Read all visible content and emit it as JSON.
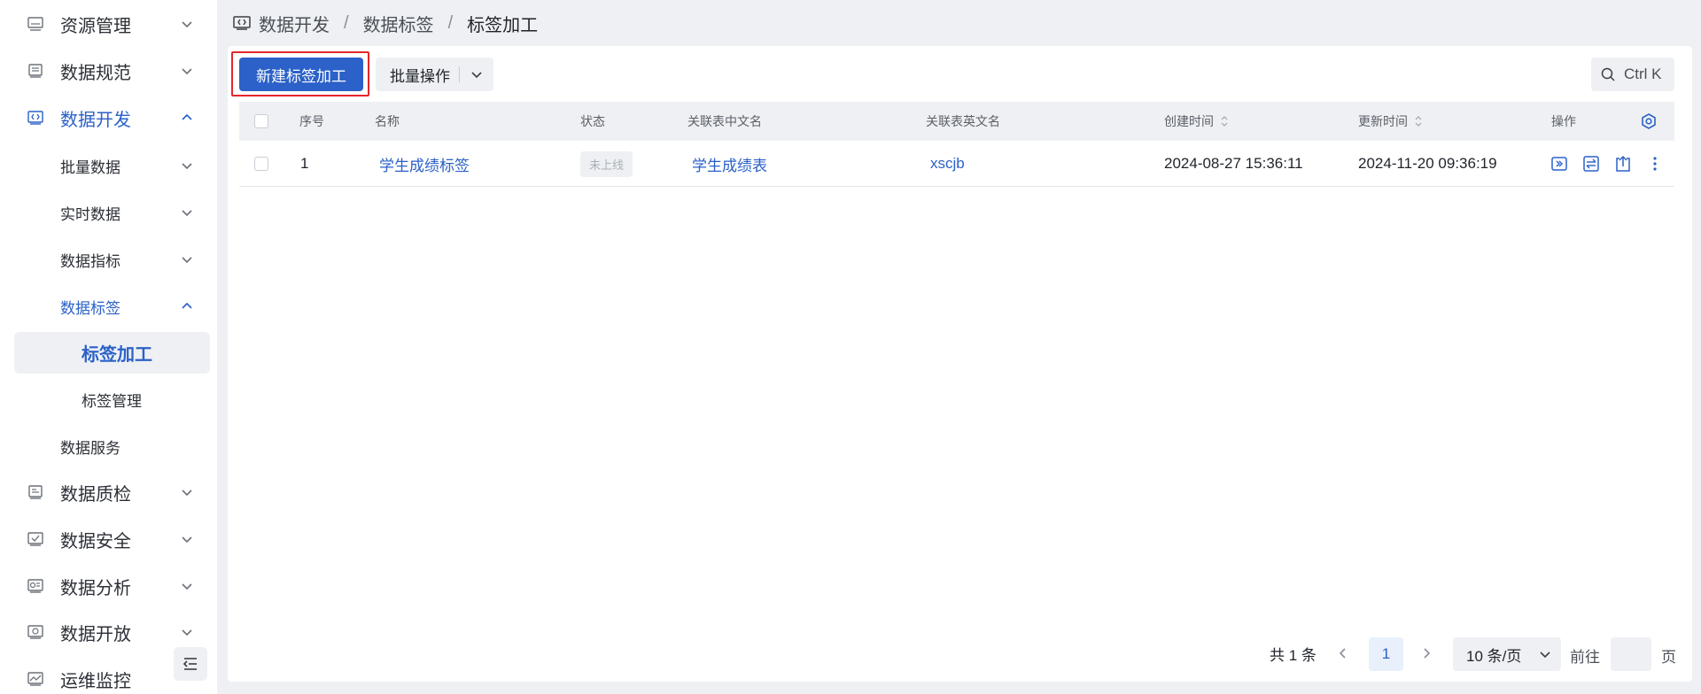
{
  "sidebar": {
    "items": [
      {
        "label": "资源管理",
        "icon": "server-icon"
      },
      {
        "label": "数据规范",
        "icon": "document-icon"
      },
      {
        "label": "数据开发",
        "icon": "code-icon"
      },
      {
        "label": "批量数据"
      },
      {
        "label": "实时数据"
      },
      {
        "label": "数据指标"
      },
      {
        "label": "数据标签"
      },
      {
        "label": "标签加工"
      },
      {
        "label": "标签管理"
      },
      {
        "label": "数据服务"
      },
      {
        "label": "数据质检",
        "icon": "inspect-icon"
      },
      {
        "label": "数据安全",
        "icon": "shield-check-icon"
      },
      {
        "label": "数据分析",
        "icon": "analysis-icon"
      },
      {
        "label": "数据开放",
        "icon": "share-icon"
      },
      {
        "label": "运维监控",
        "icon": "monitor-icon"
      }
    ]
  },
  "breadcrumb": {
    "items": [
      "数据开发",
      "数据标签",
      "标签加工"
    ],
    "separator": "/"
  },
  "toolbar": {
    "new_label": "新建标签加工",
    "batch_label": "批量操作",
    "search_shortcut": "Ctrl K"
  },
  "table": {
    "columns": [
      "序号",
      "名称",
      "状态",
      "关联表中文名",
      "关联表英文名",
      "创建时间",
      "更新时间",
      "操作"
    ],
    "rows": [
      {
        "index": "1",
        "name": "学生成绩标签",
        "status": "未上线",
        "table_cn": "学生成绩表",
        "table_en": "xscjb",
        "created": "2024-08-27 15:36:11",
        "updated": "2024-11-20 09:36:19"
      }
    ],
    "row_actions": [
      "run-icon",
      "switch-icon",
      "publish-icon",
      "more-icon"
    ],
    "settings_icon": "settings-icon"
  },
  "pagination": {
    "total": "共 1 条",
    "page": "1",
    "page_size": "10 条/页",
    "goto_label": "前往",
    "goto_value": "",
    "page_unit": "页"
  },
  "colors": {
    "primary": "#2b61c8",
    "highlight": "#e5262c",
    "background": "#eef0f3"
  }
}
